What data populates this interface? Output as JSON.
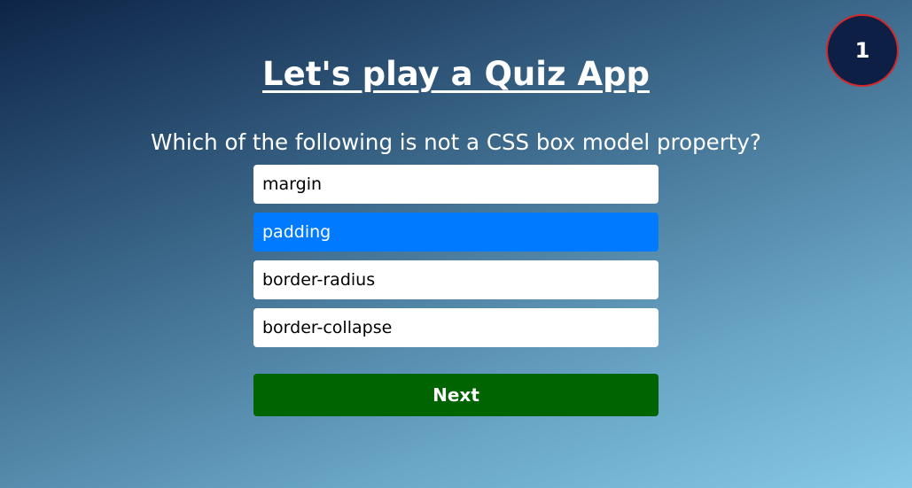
{
  "score_badge": {
    "value": "1"
  },
  "title": "Let's play a Quiz App",
  "question": "Which of the following is not a CSS box model property?",
  "options": [
    {
      "label": "margin",
      "selected": false
    },
    {
      "label": "padding",
      "selected": true
    },
    {
      "label": "border-radius",
      "selected": false
    },
    {
      "label": "border-collapse",
      "selected": false
    }
  ],
  "next_button": {
    "label": "Next"
  },
  "colors": {
    "selected_option": "#007bff",
    "next_button": "#006400",
    "badge_bg": "#0d1f45",
    "badge_border": "#d42828"
  }
}
